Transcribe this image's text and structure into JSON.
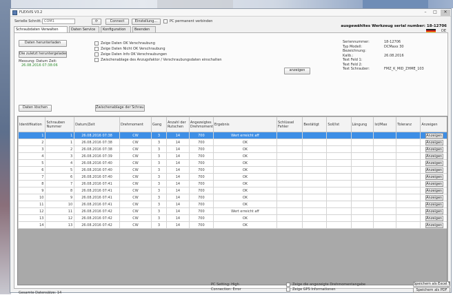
{
  "window": {
    "title": "FLEXVIS V3.2"
  },
  "header": {
    "serial_label": "Serielle Schnitt..:",
    "serial_value": "COM1",
    "connect_label": "Connect",
    "settings_label": "Einstellung...",
    "pc_permanent_label": "PC permanent verbinden",
    "lang_code": "DE",
    "tool_info": "ausgewähltes Werkzeug serial number: 18-12706"
  },
  "tabs": [
    "Schraubdaten Verwalten",
    "Daten Service",
    "Konfiguration",
    "Beenden"
  ],
  "left_buttons": {
    "read_data": "Daten herunterladen",
    "select_date": "Die zuletzt heruntergeladenen...",
    "date_range_label": "Messung: Datum Zeit:",
    "date_range_value": "26.08.2016 07:38:06",
    "clear_data": "Daten löschen",
    "export_data": "Zwischenablage der Schraub..."
  },
  "options": [
    "Zeige Daten OK Verschraubung",
    "Zeige Daten Nicht OK Verschraubung",
    "Zeige Daten Info OK Verschraubungen",
    "Zwischenablage des Anzugsfaktor / Verschraubungsdaten einschalten"
  ],
  "anzeigen_label": "anzeigen",
  "info": {
    "labels": [
      "Seriennummer:",
      "Typ Modell:",
      "Bezeichnung:",
      "Kalib.:",
      "Text Feld 1:",
      "Text Feld 2:",
      "Text Schrauber:"
    ],
    "values": [
      "18-12706",
      "DCMaxx 30",
      "",
      "26.08.2016",
      "",
      "",
      "FMZ_K_MID_ZHME_103"
    ]
  },
  "table": {
    "headers": [
      "Identifikation",
      "Schrauben Nummer",
      "Datum/Zeit",
      "Drehmoment",
      "Gang",
      "Anzahl der Rutschen",
      "Angezeigtes Drehmoment",
      "Ergebnis",
      "Schlüssel Fehler",
      "Bestätigt",
      "Soll/Ist",
      "Längung",
      "Ist/Max",
      "Toleranz",
      "Anzeigen"
    ],
    "button_label": "Anzeigen",
    "rows": [
      {
        "id": "1",
        "num": "1",
        "dt": "26.08.2016 07:38",
        "tq": "CW",
        "gang": "3",
        "anz": "14",
        "val": "700",
        "res": "Wert erreicht aff"
      },
      {
        "id": "2",
        "num": "1",
        "dt": "26.08.2016 07:38",
        "tq": "CW",
        "gang": "3",
        "anz": "14",
        "val": "700",
        "res": "OK"
      },
      {
        "id": "3",
        "num": "2",
        "dt": "26.08.2016 07:38",
        "tq": "CW",
        "gang": "3",
        "anz": "14",
        "val": "700",
        "res": "OK"
      },
      {
        "id": "4",
        "num": "3",
        "dt": "26.08.2016 07:39",
        "tq": "CW",
        "gang": "3",
        "anz": "14",
        "val": "700",
        "res": "OK"
      },
      {
        "id": "5",
        "num": "4",
        "dt": "26.08.2016 07:40",
        "tq": "CW",
        "gang": "3",
        "anz": "14",
        "val": "700",
        "res": "OK"
      },
      {
        "id": "6",
        "num": "5",
        "dt": "26.08.2016 07:40",
        "tq": "CW",
        "gang": "3",
        "anz": "14",
        "val": "700",
        "res": "OK"
      },
      {
        "id": "7",
        "num": "6",
        "dt": "26.08.2016 07:40",
        "tq": "CW",
        "gang": "3",
        "anz": "14",
        "val": "700",
        "res": "OK"
      },
      {
        "id": "8",
        "num": "7",
        "dt": "26.08.2016 07:41",
        "tq": "CW",
        "gang": "3",
        "anz": "14",
        "val": "700",
        "res": "OK"
      },
      {
        "id": "9",
        "num": "8",
        "dt": "26.08.2016 07:41",
        "tq": "CW",
        "gang": "3",
        "anz": "14",
        "val": "700",
        "res": "OK"
      },
      {
        "id": "10",
        "num": "9",
        "dt": "26.08.2016 07:41",
        "tq": "CW",
        "gang": "3",
        "anz": "14",
        "val": "700",
        "res": "OK"
      },
      {
        "id": "11",
        "num": "10",
        "dt": "26.08.2016 07:41",
        "tq": "CW",
        "gang": "3",
        "anz": "14",
        "val": "700",
        "res": "OK"
      },
      {
        "id": "12",
        "num": "11",
        "dt": "26.08.2016 07:42",
        "tq": "CW",
        "gang": "3",
        "anz": "14",
        "val": "700",
        "res": "Wert erreicht aff"
      },
      {
        "id": "13",
        "num": "12",
        "dt": "26.08.2016 07:42",
        "tq": "CW",
        "gang": "3",
        "anz": "14",
        "val": "700",
        "res": "OK"
      },
      {
        "id": "14",
        "num": "13",
        "dt": "26.08.2016 07:42",
        "tq": "CW",
        "gang": "3",
        "anz": "14",
        "val": "700",
        "res": "OK"
      }
    ]
  },
  "footer": {
    "total_label": "Gesamte Datensätze: 14",
    "pc_setting": "PC Setting: High",
    "connection": "Connection: Error",
    "opt1": "Zeige die angezeigte Drehmomentangabe",
    "opt2": "Zeige GPS Informationen",
    "btn_export": "Speichern als Excel Tabelle",
    "btn_print": "Speichern als PDF"
  },
  "colors": {
    "selected_row": "#3d8ee6",
    "accent_green": "#2e8b2e"
  }
}
